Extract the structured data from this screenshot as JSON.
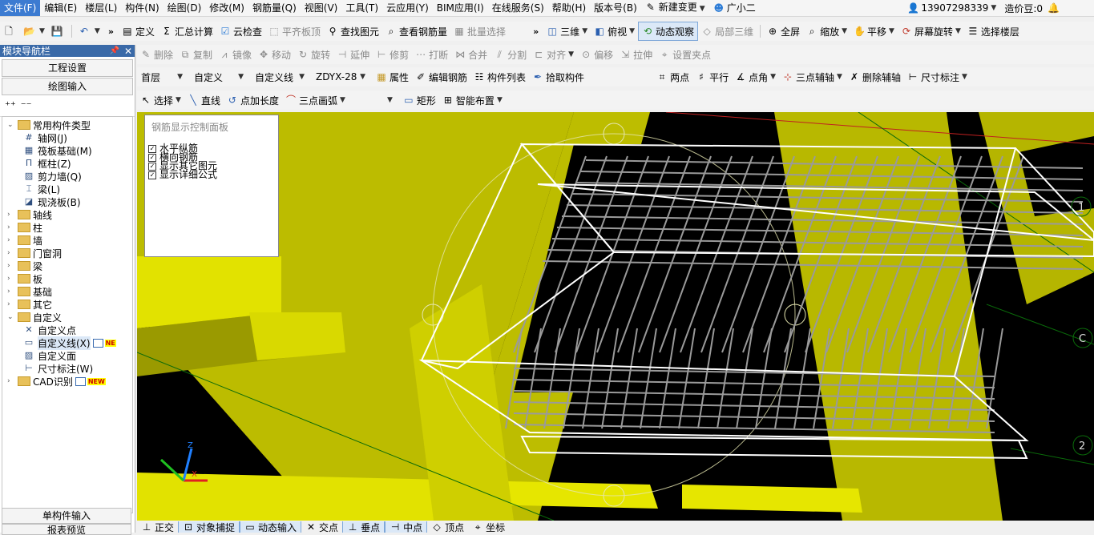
{
  "menu": [
    "文件(F)",
    "编辑(E)",
    "楼层(L)",
    "构件(N)",
    "绘图(D)",
    "修改(M)",
    "钢筋量(Q)",
    "视图(V)",
    "工具(T)",
    "云应用(Y)",
    "BIM应用(I)",
    "在线服务(S)",
    "帮助(H)",
    "版本号(B)",
    "新建变更",
    "广小二"
  ],
  "account": {
    "phone": "13907298339",
    "cost": "造价豆:0"
  },
  "toolbar1": {
    "define": "定义",
    "sum": "汇总计算",
    "cloud_check": "云检查",
    "flat_top": "平齐板顶",
    "find_element": "查找图元",
    "view_rebar": "查看钢筋量",
    "batch_select": "批量选择",
    "view3d": "三维",
    "topview": "俯视",
    "dynamic_observe": "动态观察",
    "local3d": "局部三维",
    "fullscreen": "全屏",
    "zoom": "缩放",
    "pan": "平移",
    "screen_rotate": "屏幕旋转",
    "select_floor": "选择楼层"
  },
  "toolbar2": [
    "删除",
    "复制",
    "镜像",
    "移动",
    "旋转",
    "延伸",
    "修剪",
    "打断",
    "合并",
    "分割",
    "对齐",
    "偏移",
    "拉伸",
    "设置夹点"
  ],
  "toolbar3": {
    "floor": "首层",
    "category": "自定义",
    "element_type": "自定义线",
    "element_name": "ZDYX-28",
    "property": "属性",
    "edit_rebar": "编辑钢筋",
    "element_list": "构件列表",
    "pick_element": "拾取构件",
    "two_points": "两点",
    "parallel": "平行",
    "point_angle": "点角",
    "three_point_axis": "三点辅轴",
    "delete_axis": "删除辅轴",
    "dimension": "尺寸标注"
  },
  "toolbar4": {
    "select": "选择",
    "line": "直线",
    "point_length": "点加长度",
    "arc_three": "三点画弧",
    "rect": "矩形",
    "smart_layout": "智能布置"
  },
  "nav": {
    "title": "模块导航栏",
    "project_settings": "工程设置",
    "drawing_input": "绘图输入",
    "tree": [
      {
        "label": "常用构件类型",
        "level": 0,
        "kind": "folder",
        "expanded": true
      },
      {
        "label": "轴网(J)",
        "level": 1,
        "kind": "item",
        "icon": "grid-icon"
      },
      {
        "label": "筏板基础(M)",
        "level": 1,
        "kind": "item",
        "icon": "raft-icon"
      },
      {
        "label": "框柱(Z)",
        "level": 1,
        "kind": "item",
        "icon": "column-icon"
      },
      {
        "label": "剪力墙(Q)",
        "level": 1,
        "kind": "item",
        "icon": "wall-icon"
      },
      {
        "label": "梁(L)",
        "level": 1,
        "kind": "item",
        "icon": "beam-icon"
      },
      {
        "label": "现浇板(B)",
        "level": 1,
        "kind": "item",
        "icon": "slab-icon"
      },
      {
        "label": "轴线",
        "level": 0,
        "kind": "folder",
        "expanded": false
      },
      {
        "label": "柱",
        "level": 0,
        "kind": "folder",
        "expanded": false
      },
      {
        "label": "墙",
        "level": 0,
        "kind": "folder",
        "expanded": false
      },
      {
        "label": "门窗洞",
        "level": 0,
        "kind": "folder",
        "expanded": false
      },
      {
        "label": "梁",
        "level": 0,
        "kind": "folder",
        "expanded": false
      },
      {
        "label": "板",
        "level": 0,
        "kind": "folder",
        "expanded": false
      },
      {
        "label": "基础",
        "level": 0,
        "kind": "folder",
        "expanded": false
      },
      {
        "label": "其它",
        "level": 0,
        "kind": "folder",
        "expanded": false
      },
      {
        "label": "自定义",
        "level": 0,
        "kind": "folder",
        "expanded": true
      },
      {
        "label": "自定义点",
        "level": 1,
        "kind": "item",
        "icon": "custom-point-icon"
      },
      {
        "label": "自定义线(X)",
        "level": 1,
        "kind": "item",
        "icon": "custom-line-icon",
        "selected": true,
        "badge": "NE"
      },
      {
        "label": "自定义面",
        "level": 1,
        "kind": "item",
        "icon": "custom-face-icon"
      },
      {
        "label": "尺寸标注(W)",
        "level": 1,
        "kind": "item",
        "icon": "dimension-icon"
      },
      {
        "label": "CAD识别",
        "level": 0,
        "kind": "folder",
        "expanded": false,
        "badge": "NEW"
      }
    ],
    "single_input": "单构件输入",
    "report_preview": "报表预览"
  },
  "control_panel": {
    "title": "钢筋显示控制面板",
    "options": [
      {
        "label": "水平纵筋",
        "checked": true
      },
      {
        "label": "横向钢筋",
        "checked": true
      },
      {
        "label": "显示其它图元",
        "checked": true
      },
      {
        "label": "显示详细公式",
        "checked": true
      }
    ]
  },
  "axis_labels": {
    "x": "X",
    "y": "Y",
    "z": "Z"
  },
  "grid_labels": [
    "1",
    "C",
    "2"
  ],
  "statusbar": [
    "正交",
    "对象捕捉",
    "动态输入",
    "交点",
    "垂点",
    "中点",
    "顶点",
    "坐标"
  ],
  "colors": {
    "slab_yellow": "#bcbc00",
    "beam_yellow": "#e2e200",
    "rebar": "#9a9a9a",
    "frame": "#ffffff",
    "nav_title": "#3a6aa8"
  }
}
